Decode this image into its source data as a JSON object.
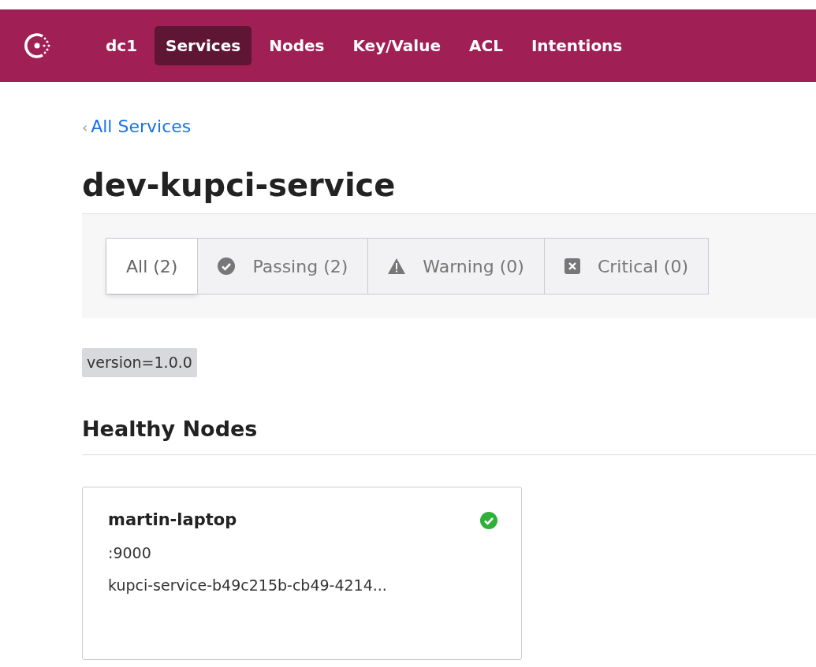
{
  "nav": {
    "datacenter": "dc1",
    "items": [
      {
        "label": "Services",
        "selected": true
      },
      {
        "label": "Nodes",
        "selected": false
      },
      {
        "label": "Key/Value",
        "selected": false
      },
      {
        "label": "ACL",
        "selected": false
      },
      {
        "label": "Intentions",
        "selected": false
      }
    ]
  },
  "breadcrumb": {
    "icon": "‹",
    "label": "All Services"
  },
  "title": "dev-kupci-service",
  "filters": [
    {
      "kind": "all",
      "label": "All (2)",
      "selected": true
    },
    {
      "kind": "passing",
      "label": "Passing (2)",
      "selected": false
    },
    {
      "kind": "warning",
      "label": "Warning (0)",
      "selected": false
    },
    {
      "kind": "critical",
      "label": "Critical (0)",
      "selected": false
    }
  ],
  "tags": [
    "version=1.0.0"
  ],
  "section_title": "Healthy Nodes",
  "nodes": [
    {
      "name": "martin-laptop",
      "kind": "passing",
      "address": ":9000",
      "service_id": "kupci-service-b49c215b-cb49-4214..."
    }
  ]
}
